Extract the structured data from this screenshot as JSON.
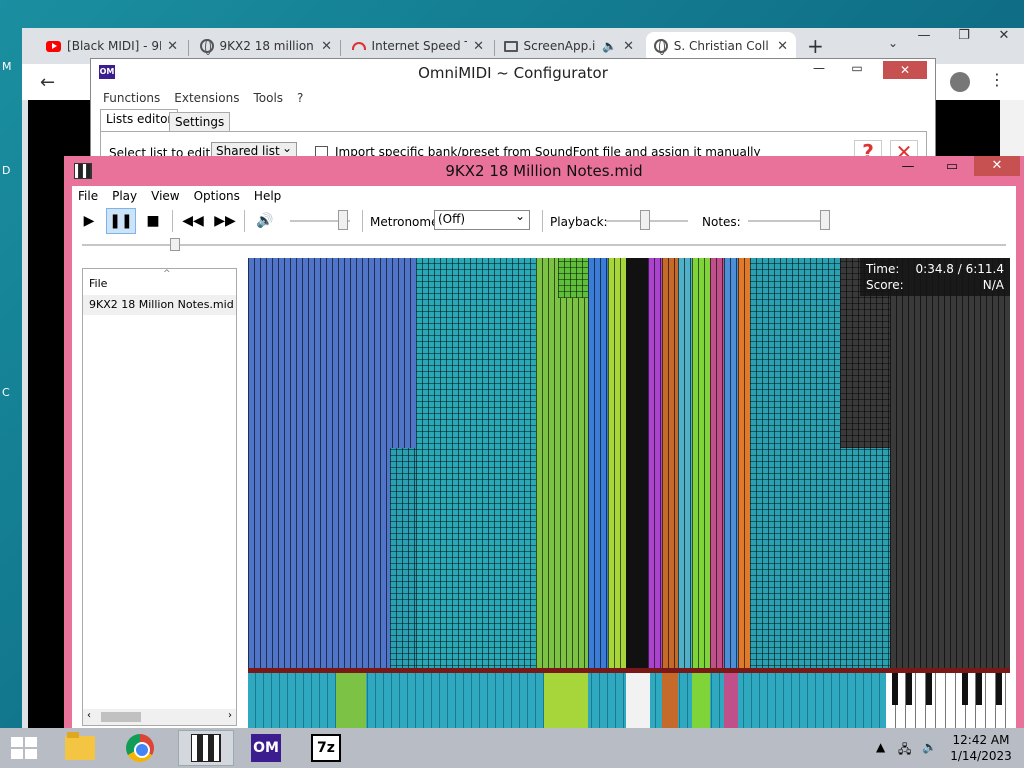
{
  "desktop": {
    "fragments": [
      "M",
      "D",
      "C"
    ]
  },
  "chrome": {
    "tabs": [
      {
        "title": "[Black MIDI] - 9K",
        "icon": "youtube-icon"
      },
      {
        "title": "9KX2 18 million",
        "icon": "globe-icon"
      },
      {
        "title": "Internet Speed T",
        "icon": "speed-gauge-icon"
      },
      {
        "title": "ScreenApp.i",
        "icon": "monitor-icon"
      },
      {
        "title": "S. Christian Coll",
        "icon": "globe-icon"
      }
    ],
    "new_tab": "+"
  },
  "omni": {
    "title": "OmniMIDI ~ Configurator",
    "menu": [
      "Functions",
      "Extensions",
      "Tools",
      "?"
    ],
    "tabs": [
      "Lists editor",
      "Settings"
    ],
    "select_label": "Select list to edit:",
    "select_value": "Shared list",
    "import_label": "Import specific bank/preset from SoundFont file and assign it manually"
  },
  "player": {
    "title": "9KX2 18 Million Notes.mid",
    "menu": [
      "File",
      "Play",
      "View",
      "Options",
      "Help"
    ],
    "metronome_label": "Metronome:",
    "metronome_value": "(Off)",
    "playback_label": "Playback:",
    "notes_label": "Notes:",
    "list_header": "File",
    "files": [
      "9KX2 18 Million Notes.mid"
    ],
    "stats": {
      "time_label": "Time:",
      "time_value": "0:34.8 / 6:11.4",
      "score_label": "Score:",
      "score_value": "N/A"
    }
  },
  "taskbar": {
    "time": "12:42 AM",
    "date": "1/14/2023"
  }
}
